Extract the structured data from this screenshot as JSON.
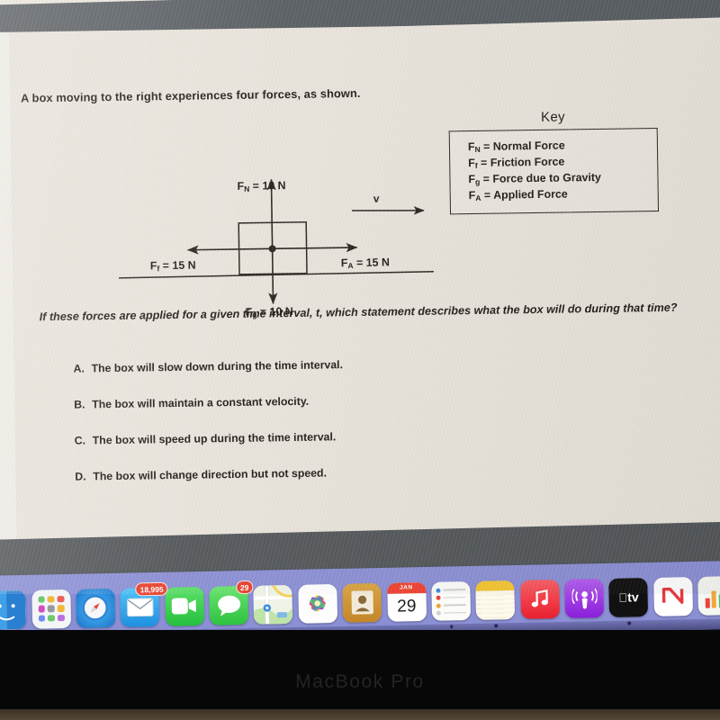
{
  "document": {
    "intro": "A box moving to the right experiences four forces, as shown.",
    "question": "If these forces are applied for a given time interval, t, which statement describes what the box will do during that time?",
    "choices": [
      {
        "letter": "A.",
        "text": "The box will slow down during the time interval."
      },
      {
        "letter": "B.",
        "text": "The box will maintain a constant velocity."
      },
      {
        "letter": "C.",
        "text": "The box will speed up during the time interval."
      },
      {
        "letter": "D.",
        "text": "The box will change direction but not speed."
      }
    ]
  },
  "key": {
    "title": "Key",
    "entries": [
      {
        "symbol": "F",
        "subscript": "N",
        "definition": "= Normal Force"
      },
      {
        "symbol": "F",
        "subscript": "f",
        "definition": "= Friction Force"
      },
      {
        "symbol": "F",
        "subscript": "g",
        "definition": "= Force due to Gravity"
      },
      {
        "symbol": "F",
        "subscript": "A",
        "definition": "= Applied Force"
      }
    ]
  },
  "diagram": {
    "normal_force_label": "F",
    "normal_force_sub": "N",
    "normal_force_value": " = 10 N",
    "gravity_label": "F",
    "gravity_sub": "g",
    "gravity_value": " = 10 N",
    "friction_label": "F",
    "friction_sub": "f",
    "friction_value": " = 15 N",
    "applied_label": "F",
    "applied_sub": "A",
    "applied_value": " = 15 N",
    "velocity_label": "v",
    "stroke_color": "#2a2420"
  },
  "dock": {
    "items": [
      {
        "name": "finder",
        "label": "Finder",
        "badge": null,
        "running": false
      },
      {
        "name": "launchpad",
        "label": "Launchpad",
        "badge": null,
        "running": false
      },
      {
        "name": "safari",
        "label": "Safari",
        "badge": null,
        "running": true
      },
      {
        "name": "mail",
        "label": "Mail",
        "badge": "18,995",
        "running": true
      },
      {
        "name": "facetime",
        "label": "FaceTime",
        "badge": null,
        "running": false
      },
      {
        "name": "messages",
        "label": "Messages",
        "badge": "29",
        "running": false
      },
      {
        "name": "maps",
        "label": "Maps",
        "badge": null,
        "running": false
      },
      {
        "name": "photos",
        "label": "Photos",
        "badge": null,
        "running": false
      },
      {
        "name": "contacts",
        "label": "Contacts",
        "badge": null,
        "running": false
      },
      {
        "name": "calendar",
        "label": "Calendar",
        "badge": null,
        "running": false
      },
      {
        "name": "reminders",
        "label": "Reminders",
        "badge": null,
        "running": true
      },
      {
        "name": "notes",
        "label": "Notes",
        "badge": null,
        "running": true
      },
      {
        "name": "music",
        "label": "Music",
        "badge": null,
        "running": false
      },
      {
        "name": "podcasts",
        "label": "Podcasts",
        "badge": null,
        "running": false
      },
      {
        "name": "appletv",
        "label": "Apple TV",
        "badge": null,
        "running": true
      },
      {
        "name": "news",
        "label": "News",
        "badge": null,
        "running": false
      },
      {
        "name": "numbers",
        "label": "Numbers",
        "badge": null,
        "running": false
      }
    ],
    "calendar_month": "JAN",
    "calendar_day": "29",
    "appletv_label": "tv",
    "background_color": "#8b8fd4"
  },
  "device": {
    "brand_text": "MacBook Pro",
    "bezel_color": "#070707"
  }
}
